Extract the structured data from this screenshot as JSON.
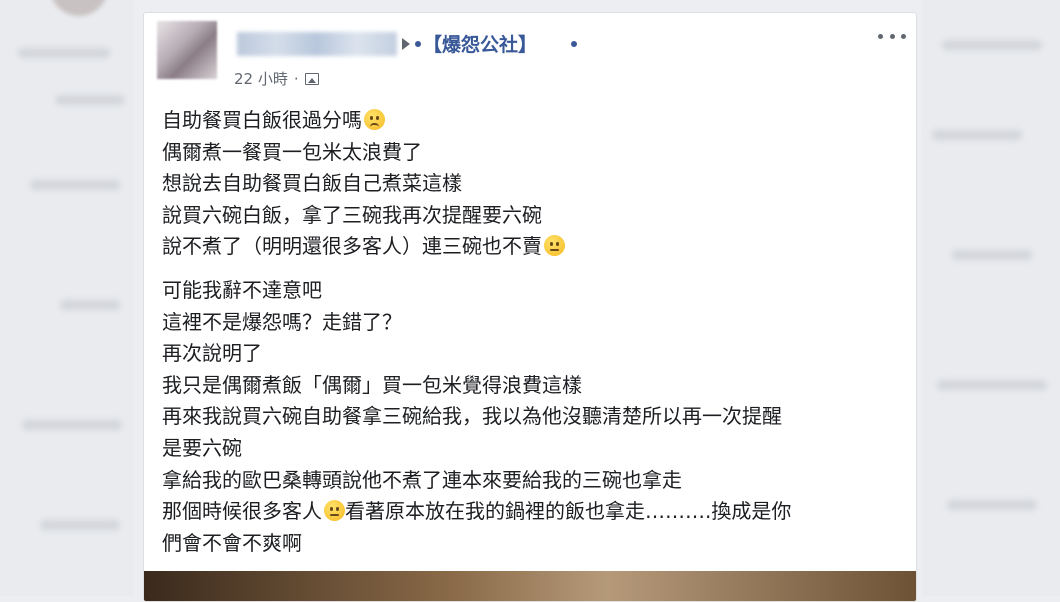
{
  "post": {
    "group_name": "【爆怨公社】",
    "timestamp": "22 小時",
    "separator": "·",
    "privacy_icon": "photo-icon",
    "more_icon": "more-options-icon",
    "paragraph1": [
      "自助餐買白飯很過分嗎",
      "偶爾煮一餐買一包米太浪費了",
      "想說去自助餐買白飯自己煮菜這樣",
      "說買六碗白飯，拿了三碗我再次提醒要六碗",
      "說不煮了（明明還很多客人）連三碗也不賣"
    ],
    "paragraph2": [
      "可能我辭不達意吧",
      "這裡不是爆怨嗎？走錯了？",
      "再次說明了",
      "我只是偶爾煮飯「偶爾」買一包米覺得浪費這樣",
      "再來我說買六碗自助餐拿三碗給我，我以為他沒聽清楚所以再一次提醒",
      "是要六碗",
      "拿給我的歐巴桑轉頭說他不煮了連本來要給我的三碗也拿走",
      "那個時候很多客人",
      "看著原本放在我的鍋裡的飯也拿走……….換成是你",
      "們會不會不爽啊"
    ]
  },
  "colors": {
    "group_link": "#385898",
    "text": "#1c1e21",
    "meta": "#616770"
  }
}
